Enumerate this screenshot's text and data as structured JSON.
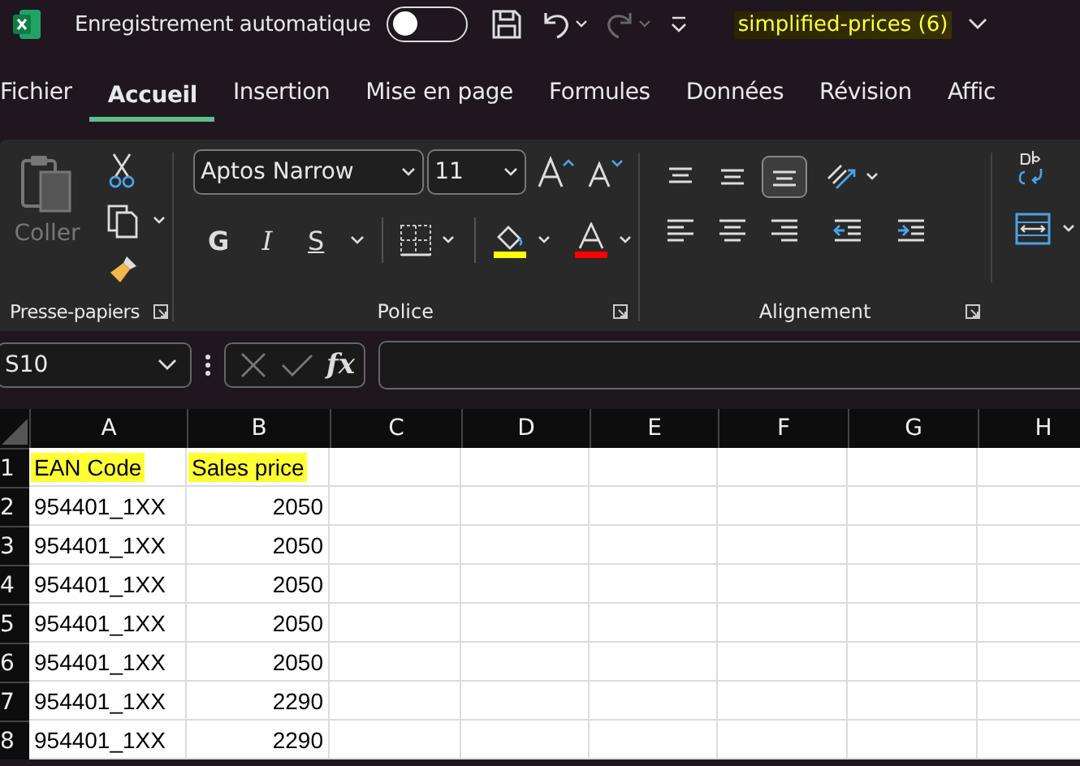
{
  "title_bar": {
    "autosave_label": "Enregistrement automatique",
    "autosave_on": false,
    "file_name": "simplified-prices (6)",
    "file_name_highlighted": true
  },
  "tabs": [
    {
      "label": "Fichier",
      "selected": false
    },
    {
      "label": "Accueil",
      "selected": true
    },
    {
      "label": "Insertion",
      "selected": false
    },
    {
      "label": "Mise en page",
      "selected": false
    },
    {
      "label": "Formules",
      "selected": false
    },
    {
      "label": "Données",
      "selected": false
    },
    {
      "label": "Révision",
      "selected": false
    },
    {
      "label": "Affic",
      "selected": false
    }
  ],
  "ribbon": {
    "paste_label": "Coller",
    "paste_disabled": true,
    "font_name": "Aptos Narrow",
    "font_size": "11",
    "bold_label": "G",
    "italic_label": "I",
    "underline_label": "S",
    "groups": [
      "Presse-papiers",
      "Police",
      "Alignement"
    ]
  },
  "formula_bar": {
    "name_box": "S10",
    "fx_label": "fx"
  },
  "sheet": {
    "columns": [
      "A",
      "B",
      "C",
      "D",
      "E",
      "F",
      "G",
      "H"
    ],
    "rows": [
      {
        "number": "1",
        "cells": [
          {
            "text": "EAN Code",
            "kind": "text",
            "highlighted": true
          },
          {
            "text": "Sales price",
            "kind": "text",
            "highlighted": true
          }
        ]
      },
      {
        "number": "2",
        "cells": [
          {
            "text": "954401_1XX",
            "kind": "text",
            "highlighted": false
          },
          {
            "text": "2050",
            "kind": "number",
            "highlighted": false
          }
        ]
      },
      {
        "number": "3",
        "cells": [
          {
            "text": "954401_1XX",
            "kind": "text",
            "highlighted": false
          },
          {
            "text": "2050",
            "kind": "number",
            "highlighted": false
          }
        ]
      },
      {
        "number": "4",
        "cells": [
          {
            "text": "954401_1XX",
            "kind": "text",
            "highlighted": false
          },
          {
            "text": "2050",
            "kind": "number",
            "highlighted": false
          }
        ]
      },
      {
        "number": "5",
        "cells": [
          {
            "text": "954401_1XX",
            "kind": "text",
            "highlighted": false
          },
          {
            "text": "2050",
            "kind": "number",
            "highlighted": false
          }
        ]
      },
      {
        "number": "6",
        "cells": [
          {
            "text": "954401_1XX",
            "kind": "text",
            "highlighted": false
          },
          {
            "text": "2050",
            "kind": "number",
            "highlighted": false
          }
        ]
      },
      {
        "number": "7",
        "cells": [
          {
            "text": "954401_1XX",
            "kind": "text",
            "highlighted": false
          },
          {
            "text": "2290",
            "kind": "number",
            "highlighted": false
          }
        ]
      },
      {
        "number": "8",
        "cells": [
          {
            "text": "954401_1XX",
            "kind": "text",
            "highlighted": false
          },
          {
            "text": "2290",
            "kind": "number",
            "highlighted": false
          }
        ]
      }
    ]
  }
}
